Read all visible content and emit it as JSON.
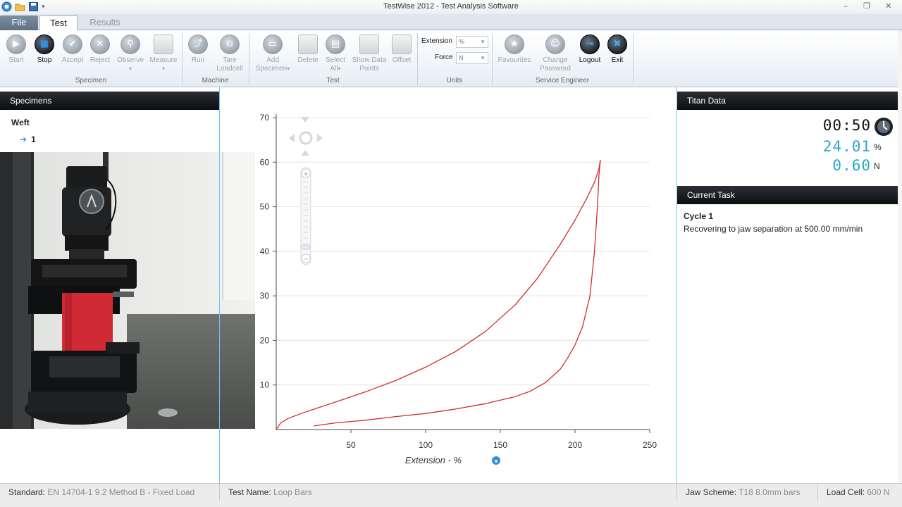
{
  "window": {
    "title": "TestWise 2012 - Test Analysis Software"
  },
  "tabs": {
    "file": "File",
    "test": "Test",
    "results": "Results"
  },
  "ribbon": {
    "specimen_group": {
      "label": "Specimen",
      "start": "Start",
      "stop": "Stop",
      "accept": "Accept",
      "reject": "Reject",
      "observe": "Observe",
      "measure": "Measure"
    },
    "machine_group": {
      "label": "Machine",
      "run": "Run",
      "tare_line1": "Tare",
      "tare_line2": "Loadcell"
    },
    "test_group": {
      "label": "Test",
      "add_line1": "Add",
      "add_line2": "Specimen",
      "delete": "Delete",
      "select_line1": "Select",
      "select_line2": "All",
      "show_line1": "Show Data",
      "show_line2": "Points",
      "offset": "Offset"
    },
    "units_group": {
      "label": "Units",
      "extension_label": "Extension",
      "extension_value": "%",
      "force_label": "Force",
      "force_value": "N"
    },
    "service_group": {
      "label": "Service Engineer",
      "favourites": "Favourites",
      "change_line1": "Change",
      "change_line2": "Password",
      "logout": "Logout",
      "exit": "Exit"
    }
  },
  "specimens": {
    "header": "Specimens",
    "root": "Weft",
    "item": "1"
  },
  "chart_data": {
    "type": "line",
    "xlabel": "Extension - %",
    "ylabel": "",
    "xlim": [
      0,
      250
    ],
    "ylim": [
      0,
      70
    ],
    "xticks": [
      "50",
      "100",
      "150",
      "200",
      "250"
    ],
    "yticks": [
      "10",
      "20",
      "30",
      "40",
      "50",
      "60",
      "70"
    ],
    "grid": "horizontal",
    "line_color": "#d42b2b",
    "series": [
      {
        "x": [
          0,
          3,
          8,
          20,
          40,
          60,
          80,
          100,
          120,
          140,
          160,
          175,
          190,
          200,
          208,
          213,
          216,
          217
        ],
        "values": [
          0,
          1.5,
          2.5,
          4,
          6.2,
          8.5,
          11,
          14,
          17.5,
          22,
          28,
          34,
          41.5,
          47,
          52,
          55.5,
          58.5,
          60.5
        ]
      },
      {
        "x": [
          217,
          216,
          215,
          213,
          210,
          205,
          200,
          195,
          190,
          180,
          170,
          160,
          140,
          120,
          100,
          80,
          60,
          40,
          25
        ],
        "values": [
          60.5,
          57,
          50,
          40,
          30,
          23,
          19,
          16,
          13.5,
          10.5,
          8.6,
          7.4,
          5.8,
          4.6,
          3.6,
          2.9,
          2.1,
          1.5,
          0.8
        ]
      }
    ]
  },
  "titan": {
    "header": "Titan Data",
    "time": "00:50",
    "extension": "24.01",
    "extension_unit": "%",
    "force": "0.60",
    "force_unit": "N"
  },
  "task": {
    "header": "Current Task",
    "title": "Cycle 1",
    "description": "Recovering to jaw separation at 500.00 mm/min"
  },
  "status": {
    "standard_key": "Standard:",
    "standard_value": "EN 14704-1 9.2 Method B - Fixed Load",
    "testname_key": "Test Name:",
    "testname_value": "Loop Bars",
    "jaw_key": "Jaw Scheme:",
    "jaw_value": "T18 8.0mm bars",
    "loadcell_key": "Load Cell:",
    "loadcell_value": "600 N"
  },
  "colors": {
    "accent": "#2aa7c9",
    "header_bg": "#111417",
    "curve": "#d42b2b"
  }
}
